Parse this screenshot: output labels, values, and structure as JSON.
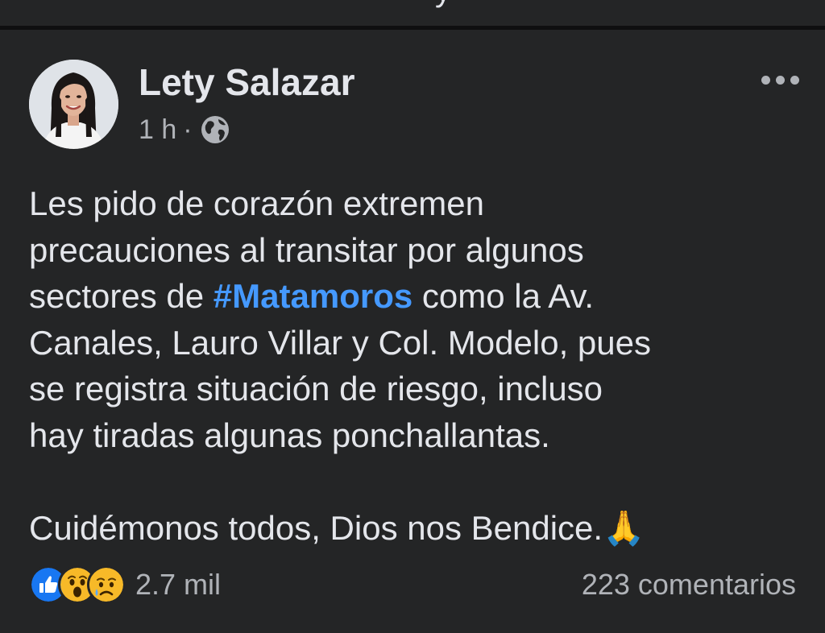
{
  "post": {
    "author": "Lety Salazar",
    "time": "1 h",
    "separator": "·",
    "privacy_icon": "globe-icon",
    "more_icon": "more-options-icon",
    "text": {
      "line1": "Les pido de corazón extremen",
      "line2": "precauciones al transitar por algunos",
      "line3_before": "sectores de ",
      "hashtag": "#Matamoros",
      "line3_after": " como la Av.",
      "line4": "Canales, Lauro Villar y Col. Modelo, pues",
      "line5": "se registra situación de riesgo, incluso",
      "line6": "hay tiradas algunas ponchallantas.",
      "closing": "Cuidémonos todos, Dios nos Bendice.",
      "closing_emoji": "🙏"
    }
  },
  "reactions": {
    "icons": [
      "like-reaction-icon",
      "wow-reaction-icon",
      "sad-reaction-icon"
    ],
    "count": "2.7 mil"
  },
  "comments": {
    "label": "223 comentarios"
  },
  "colors": {
    "background": "#18191a",
    "card": "#242526",
    "primary_text": "#e4e6eb",
    "secondary_text": "#b0b3b8",
    "hashtag": "#4599ff",
    "like_blue": "#1877f2",
    "reaction_yellow": "#f7b928"
  }
}
